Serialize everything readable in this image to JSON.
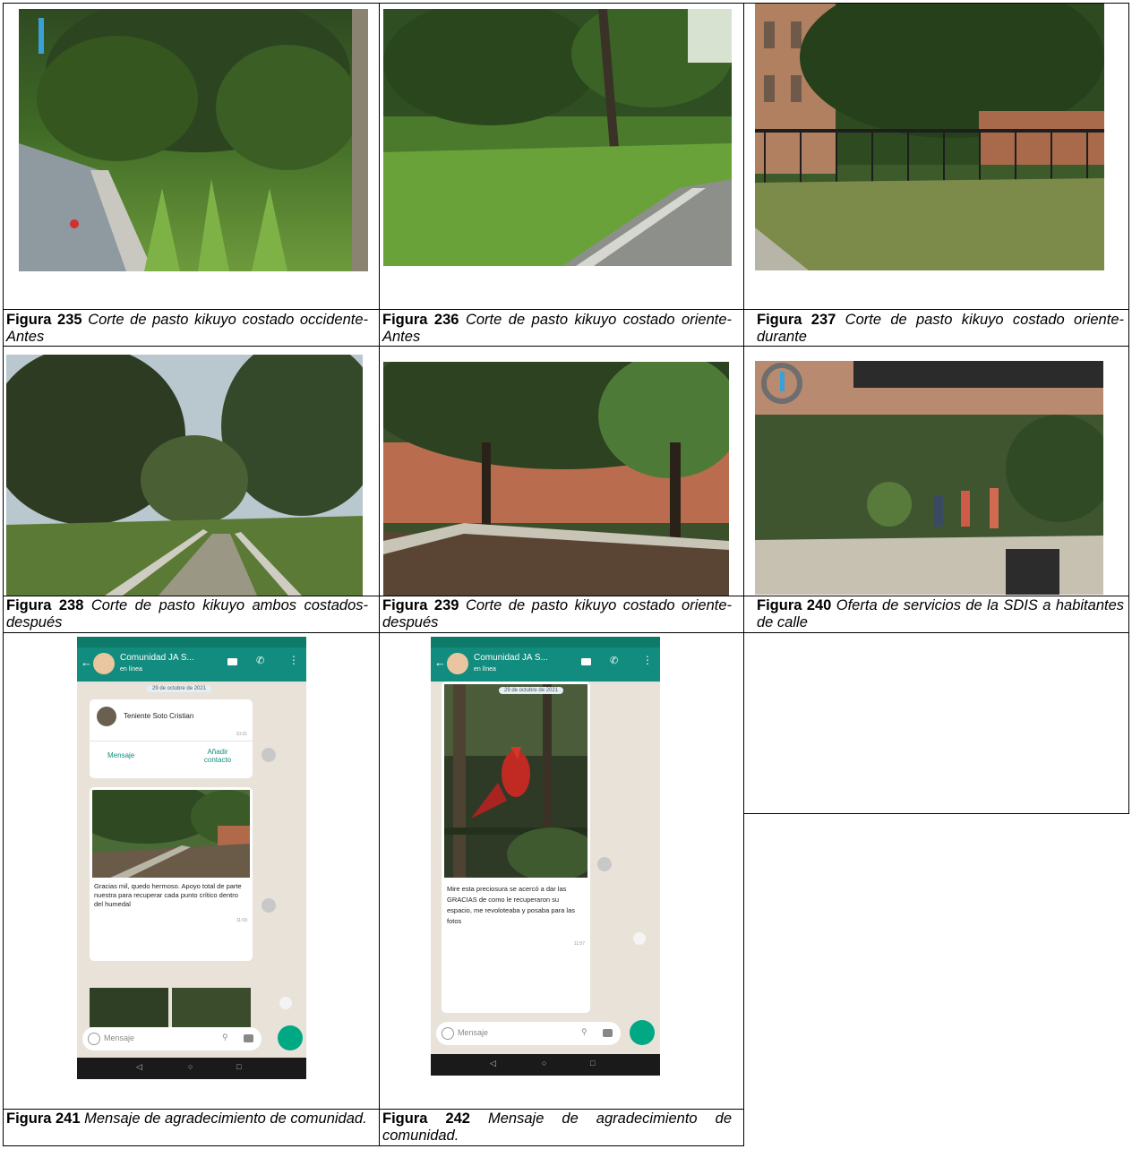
{
  "figures": [
    {
      "num": "Figura 235",
      "text": "Corte de pasto kikuyo costado occidente- Antes"
    },
    {
      "num": "Figura 236",
      "text": "Corte de pasto kikuyo costado oriente- Antes"
    },
    {
      "num": "Figura 237",
      "text": "Corte de pasto kikuyo costado oriente- durante"
    },
    {
      "num": "Figura 238",
      "text": "Corte de pasto kikuyo ambos costados- después"
    },
    {
      "num": "Figura 239",
      "text": "Corte de pasto kikuyo costado oriente- después"
    },
    {
      "num": "Figura 240",
      "text": "Oferta de servicios de la SDIS a habitantes de calle"
    },
    {
      "num": "Figura 241",
      "text": "Mensaje de agradecimiento de comunidad."
    },
    {
      "num": "Figura 242",
      "text": "Mensaje de agradecimiento de comunidad."
    }
  ],
  "phone241": {
    "chat_title": "Comunidad JA S...",
    "chat_status": "en línea",
    "date_pill": "29 de octubre de 2021",
    "contact_name": "Teniente Soto Cristian",
    "contact_time": "10:31",
    "contact_btn_message": "Mensaje",
    "contact_btn_add": "Añadir contacto",
    "message": "Gracias mil, quedo hermoso. Apoyo total de parte nuestra para recuperar cada punto crítico dentro del humedal",
    "message_time": "11:03",
    "input_placeholder": "Mensaje"
  },
  "phone242": {
    "chat_title": "Comunidad JA S...",
    "chat_status": "en línea",
    "date_pill": "29 de octubre de 2021",
    "message": "Mire esta preciosura se acercó a dar las GRACIAS de como le recuperaron su espacio, me revoloteaba y posaba para las fotos",
    "message_time": "11:57",
    "input_placeholder": "Mensaje"
  }
}
